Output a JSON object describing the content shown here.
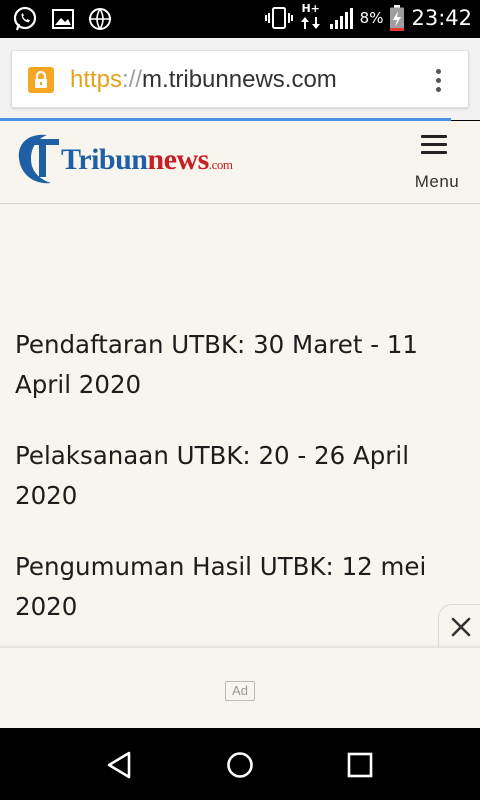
{
  "status_bar": {
    "time": "23:42",
    "battery_percent": "8%",
    "network_type": "H+",
    "left_icons": [
      "whatsapp-icon",
      "gallery-icon",
      "globe-icon"
    ],
    "right_icons": [
      "vibrate-icon",
      "data-arrows-icon",
      "signal-icon",
      "battery-charging-icon"
    ]
  },
  "browser": {
    "url_scheme": "https",
    "url_separator": "://",
    "url_host": "m.tribunnews.com",
    "page_load_progress": 0.94,
    "colors": {
      "lock": "#f6a623",
      "scheme": "#e5a21b",
      "progress": "#4b90e2"
    }
  },
  "site": {
    "logo": {
      "wordmark_main": "Tribun",
      "wordmark_accent": "news",
      "wordmark_domain": ".com"
    },
    "menu_label": "Menu",
    "colors": {
      "brand_blue": "#1f5fa6",
      "brand_red": "#c62026",
      "background": "#f7f5ee"
    }
  },
  "article": {
    "paragraphs": [
      "Pendaftaran UTBK: 30 Maret - 11 April 2020",
      "Pelaksanaan UTBK: 20 - 26 April 2020",
      "Pengumuman Hasil UTBK: 12 mei 2020"
    ]
  },
  "ad": {
    "label": "Ad",
    "close_icon": "close-icon"
  },
  "nav_bar": {
    "buttons": [
      "back-icon",
      "home-icon",
      "recents-icon"
    ]
  }
}
